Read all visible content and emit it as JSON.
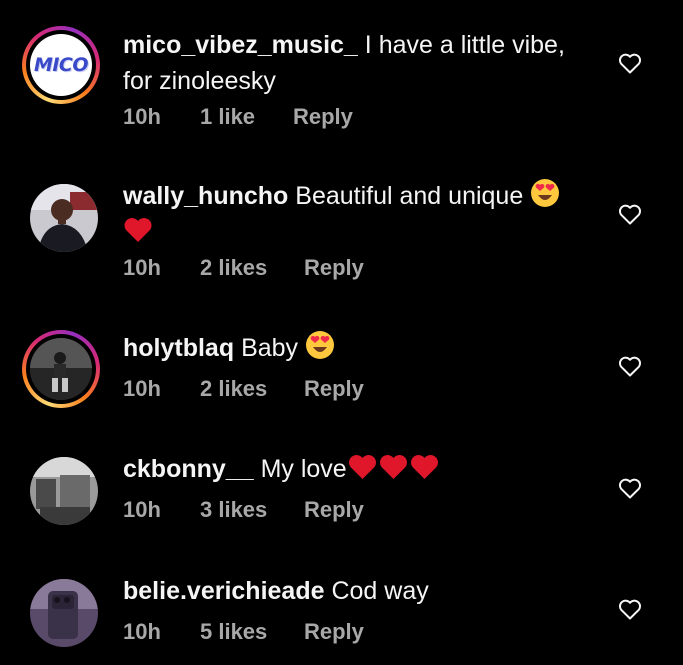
{
  "comments": [
    {
      "username": "mico_vibez_music_",
      "text": "I have a little vibe, for zinoleesky",
      "avatar_text": "MICO",
      "time": "10h",
      "likes": "1 like",
      "reply": "Reply",
      "story_ring": true
    },
    {
      "username": "wally_huncho",
      "text": "Beautiful and unique",
      "emojis": [
        "heart-eyes",
        "red-heart"
      ],
      "time": "10h",
      "likes": "2 likes",
      "reply": "Reply",
      "story_ring": false
    },
    {
      "username": "holytblaq",
      "text": "Baby",
      "emojis": [
        "heart-eyes"
      ],
      "time": "10h",
      "likes": "2 likes",
      "reply": "Reply",
      "story_ring": true
    },
    {
      "username": "ckbonny__",
      "text": "My love",
      "emojis": [
        "red-heart",
        "red-heart",
        "red-heart"
      ],
      "time": "10h",
      "likes": "3 likes",
      "reply": "Reply",
      "story_ring": false
    },
    {
      "username": "belie.verichieade",
      "text": "Cod way",
      "time": "10h",
      "likes": "5 likes",
      "reply": "Reply",
      "story_ring": false
    }
  ],
  "colors": {
    "background": "#000000",
    "text": "#f5f5f5",
    "meta": "#a8a8a8",
    "heart": "#e0162b",
    "ring_start": "#feda75",
    "ring_end": "#962fbf"
  },
  "icons": {
    "like": "heart-outline-icon"
  }
}
